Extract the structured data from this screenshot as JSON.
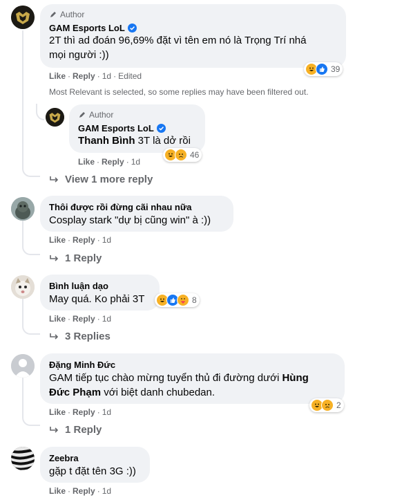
{
  "comments": [
    {
      "author_tag": "Author",
      "name": "GAM Esports LoL",
      "verified": true,
      "text_lines": [
        "2T thì ad đoán 96,69% đặt vì tên em nó là Trọng Trí nhá",
        "mọi người :))"
      ],
      "actions": {
        "like": "Like",
        "reply": "Reply",
        "time": "1d",
        "edited": "Edited"
      },
      "reactions": {
        "icons": [
          "haha-icon",
          "like-icon"
        ],
        "count": "39"
      }
    },
    {
      "author_tag": "Author",
      "name": "GAM Esports LoL",
      "verified": true,
      "mention": "Thanh Bình",
      "text": " 3T là dở rồi",
      "actions": {
        "like": "Like",
        "reply": "Reply",
        "time": "1d"
      },
      "reactions": {
        "icons": [
          "haha-icon",
          "sad-icon"
        ],
        "count": "46"
      }
    },
    {
      "name": "Thôi được rồi đừng cãi nhau nữa",
      "text": "Cosplay stark \"dự bị cũng win\" à :))",
      "actions": {
        "like": "Like",
        "reply": "Reply",
        "time": "1d"
      },
      "replies": "1 Reply"
    },
    {
      "name": "Bình luận dạo",
      "text": "May quá. Ko phải 3T",
      "actions": {
        "like": "Like",
        "reply": "Reply",
        "time": "1d"
      },
      "reactions": {
        "icons": [
          "haha-icon",
          "like-icon",
          "care-icon"
        ],
        "count": "8"
      },
      "replies": "3 Replies"
    },
    {
      "name": "Đặng Minh Đức",
      "text_pre": "GAM tiếp tục chào mừng tuyển thủ đi đường dưới ",
      "mention": "Hùng Đức Phạm",
      "text_post": " với biệt danh chubedan.",
      "line1_pre": "GAM tiếp tục chào mừng tuyển thủ đi đường dưới ",
      "line1_mention": "Hùng",
      "line2_mention": "Đức Phạm",
      "line2_post": " với biệt danh chubedan.",
      "actions": {
        "like": "Like",
        "reply": "Reply",
        "time": "1d"
      },
      "reactions": {
        "icons": [
          "haha-icon",
          "sad-icon"
        ],
        "count": "2"
      },
      "replies": "1 Reply"
    },
    {
      "name": "Zeebra",
      "text": "gặp t đặt tên 3G :))",
      "actions": {
        "like": "Like",
        "reply": "Reply",
        "time": "1d"
      }
    }
  ],
  "filter_note": "Most Relevant is selected, so some replies may have been filtered out.",
  "view_more_reply": "View 1 more reply",
  "colors": {
    "accent": "#1877f2",
    "secondary_text": "#65676b",
    "bubble": "#f0f2f5",
    "haha": "#f7b125",
    "sad": "#f7b125",
    "like": "#1877f2"
  }
}
